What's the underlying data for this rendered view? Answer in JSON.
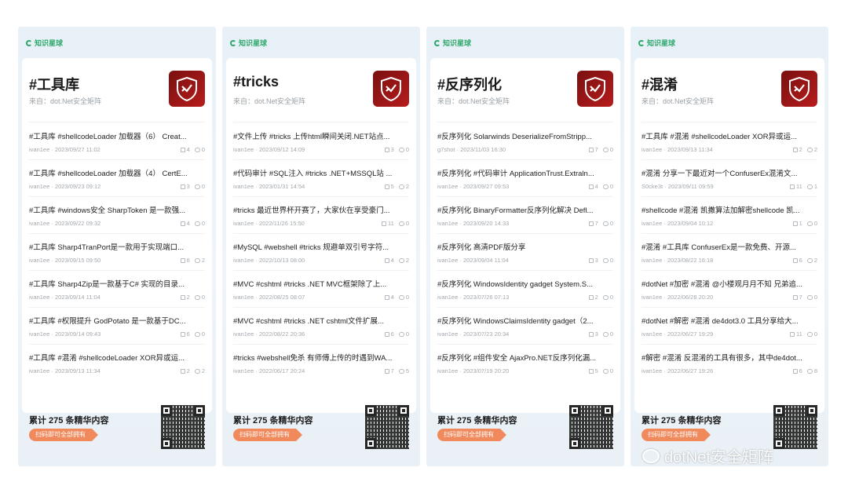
{
  "brand": "知识星球",
  "footer": {
    "total": "累计 275 条精华内容",
    "cta": "扫码即可全部拥有"
  },
  "watermark": "dotNet安全矩阵",
  "cards": [
    {
      "title": "#工具库",
      "source": "来自：dot.Net安全矩阵",
      "items": [
        {
          "title": "#工具库 #shellcodeLoader 加载器（6） Creat...",
          "author": "ivan1ee",
          "date": "2023/09/27 11:02",
          "likes": "4",
          "comments": "0"
        },
        {
          "title": "#工具库 #shellcodeLoader 加载器（4） CertE...",
          "author": "ivan1ee",
          "date": "2023/09/23 09:12",
          "likes": "3",
          "comments": "0"
        },
        {
          "title": "#工具库 #windows安全 SharpToken 是一款强...",
          "author": "ivan1ee",
          "date": "2023/09/22 09:32",
          "likes": "4",
          "comments": "0"
        },
        {
          "title": "#工具库 Sharp4TranPort是一款用于实现端口...",
          "author": "ivan1ee",
          "date": "2023/09/15 09:50",
          "likes": "6",
          "comments": "2"
        },
        {
          "title": "#工具库 Sharp4Zip是一款基于C# 实现的目录...",
          "author": "ivan1ee",
          "date": "2023/09/14 11:04",
          "likes": "2",
          "comments": "0"
        },
        {
          "title": "#工具库 #权限提升 GodPotato 是一款基于DC...",
          "author": "ivan1ee",
          "date": "2023/09/14 09:43",
          "likes": "6",
          "comments": "0"
        },
        {
          "title": "#工具库 #混淆 #shellcodeLoader XOR异或运...",
          "author": "ivan1ee",
          "date": "2023/09/13 11:34",
          "likes": "2",
          "comments": "2"
        }
      ]
    },
    {
      "title": "#tricks",
      "source": "来自：dot.Net安全矩阵",
      "items": [
        {
          "title": "#文件上传 #tricks 上传html瞬间关闭.NET站点...",
          "author": "ivan1ee",
          "date": "2023/09/12 14:09",
          "likes": "3",
          "comments": "0"
        },
        {
          "title": "#代码审计 #SQL注入 #tricks .NET+MSSQL站 ...",
          "author": "ivan1ee",
          "date": "2023/01/31 14:54",
          "likes": "5",
          "comments": "2"
        },
        {
          "title": "#tricks 最近世界杯开赛了，大家伙在享受豪门...",
          "author": "ivan1ee",
          "date": "2022/11/26 15:50",
          "likes": "11",
          "comments": "0"
        },
        {
          "title": "#MySQL #webshell #tricks 规避单双引号字符...",
          "author": "ivan1ee",
          "date": "2022/10/13 08:00",
          "likes": "4",
          "comments": "2"
        },
        {
          "title": "#MVC #cshtml #tricks .NET MVC框架除了上...",
          "author": "ivan1ee",
          "date": "2022/08/25 08:07",
          "likes": "4",
          "comments": "0"
        },
        {
          "title": "#MVC #cshtml #tricks .NET cshtml文件扩展...",
          "author": "ivan1ee",
          "date": "2022/08/22 20:36",
          "likes": "6",
          "comments": "0"
        },
        {
          "title": "#tricks #webshell免杀 有师傅上传的时遇到WA...",
          "author": "ivan1ee",
          "date": "2022/06/17 20:24",
          "likes": "7",
          "comments": "5"
        }
      ]
    },
    {
      "title": "#反序列化",
      "source": "来自：dot.Net安全矩阵",
      "items": [
        {
          "title": "#反序列化 Solarwinds DeserializeFromStripp...",
          "author": "g7shot",
          "date": "2023/11/03 16:30",
          "likes": "7",
          "comments": "0"
        },
        {
          "title": "#反序列化 #代码审计 ApplicationTrust.Extraln...",
          "author": "ivan1ee",
          "date": "2023/09/27 09:53",
          "likes": "4",
          "comments": "0"
        },
        {
          "title": "#反序列化 BinaryFormatter反序列化解决 Defl...",
          "author": "ivan1ee",
          "date": "2023/09/20 14:33",
          "likes": "7",
          "comments": "0"
        },
        {
          "title": "#反序列化 高清PDF版分享",
          "author": "ivan1ee",
          "date": "2023/09/04 11:04",
          "likes": "3",
          "comments": "0"
        },
        {
          "title": "#反序列化 WindowsIdentity gadget System.S...",
          "author": "ivan1ee",
          "date": "2023/07/26 07:13",
          "likes": "2",
          "comments": "0"
        },
        {
          "title": "#反序列化 WindowsClaimsIdentity gadget（2...",
          "author": "ivan1ee",
          "date": "2023/07/23 20:34",
          "likes": "3",
          "comments": "0"
        },
        {
          "title": "#反序列化 #组件安全 AjaxPro.NET反序列化漏...",
          "author": "ivan1ee",
          "date": "2023/07/19 20:20",
          "likes": "5",
          "comments": "0"
        }
      ]
    },
    {
      "title": "#混淆",
      "source": "来自：dot.Net安全矩阵",
      "items": [
        {
          "title": "#工具库 #混淆 #shellcodeLoader XOR异或运...",
          "author": "ivan1ee",
          "date": "2023/09/13 11:34",
          "likes": "2",
          "comments": "2"
        },
        {
          "title": "#混淆 分享一下最近对一个ConfuserEx混淆文...",
          "author": "S0cke3t",
          "date": "2023/09/11 09:59",
          "likes": "11",
          "comments": "1"
        },
        {
          "title": "#shellcode #混淆 凯撒算法加解密shellcode 凯...",
          "author": "ivan1ee",
          "date": "2023/09/04 10:12",
          "likes": "1",
          "comments": "0"
        },
        {
          "title": "#混淆 #工具库 ConfuserEx是一款免费、开源...",
          "author": "ivan1ee",
          "date": "2023/08/22 16:18",
          "likes": "6",
          "comments": "2"
        },
        {
          "title": "#dotNet #加密 #混淆 @小楼观月月不知 兄弟追...",
          "author": "ivan1ee",
          "date": "2022/06/28 20:20",
          "likes": "7",
          "comments": "0"
        },
        {
          "title": "#dotNet #解密 #混淆 de4dot3.0 工具分享给大...",
          "author": "ivan1ee",
          "date": "2022/06/27 19:29",
          "likes": "11",
          "comments": "0"
        },
        {
          "title": "#解密 #混淆 反混淆的工具有很多，其中de4dot...",
          "author": "ivan1ee",
          "date": "2022/06/27 19:26",
          "likes": "6",
          "comments": "8"
        }
      ]
    }
  ]
}
